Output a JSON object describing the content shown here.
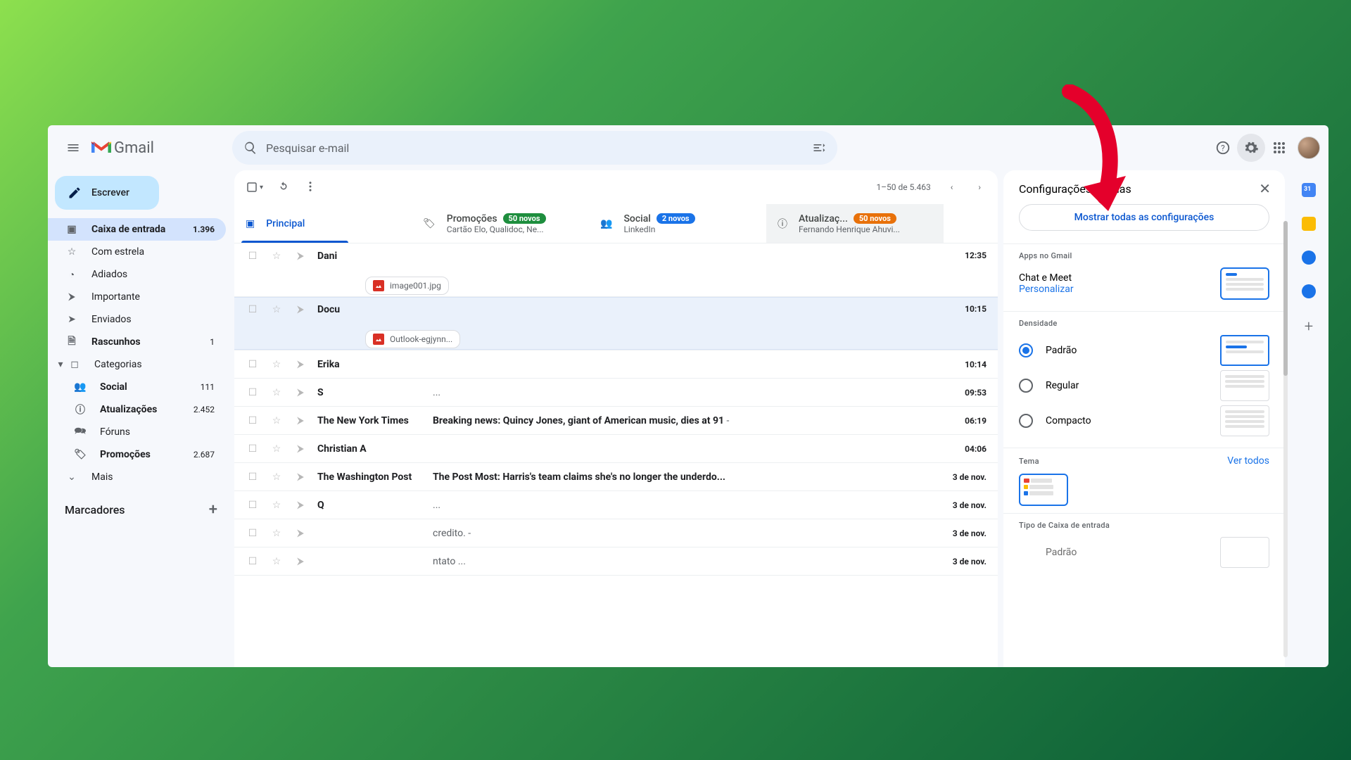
{
  "app": {
    "name": "Gmail"
  },
  "search": {
    "placeholder": "Pesquisar e-mail"
  },
  "compose": {
    "label": "Escrever"
  },
  "nav": {
    "inbox": {
      "label": "Caixa de entrada",
      "count": "1.396"
    },
    "starred": {
      "label": "Com estrela"
    },
    "snoozed": {
      "label": "Adiados"
    },
    "important": {
      "label": "Importante"
    },
    "sent": {
      "label": "Enviados"
    },
    "drafts": {
      "label": "Rascunhos",
      "count": "1"
    },
    "categories": {
      "label": "Categorias"
    },
    "social": {
      "label": "Social",
      "count": "111"
    },
    "updates": {
      "label": "Atualizações",
      "count": "2.452"
    },
    "forums": {
      "label": "Fóruns"
    },
    "promotions": {
      "label": "Promoções",
      "count": "2.687"
    },
    "more": {
      "label": "Mais"
    }
  },
  "labels_header": "Marcadores",
  "toolbar": {
    "range": "1–50 de 5.463"
  },
  "tabs": {
    "primary": {
      "label": "Principal"
    },
    "promo": {
      "label": "Promoções",
      "badge": "50 novos",
      "sub": "Cartão Elo, Qualidoc, Ne..."
    },
    "social": {
      "label": "Social",
      "badge": "2 novos",
      "sub": "LinkedIn"
    },
    "updates": {
      "label": "Atualizaç...",
      "badge": "50 novos",
      "sub": "Fernando Henrique Ahuvi..."
    }
  },
  "rows": [
    {
      "sender": "Dani",
      "subject": "",
      "time": "12:35",
      "attach": "image001.jpg"
    },
    {
      "sender": "Docu",
      "subject": "",
      "time": "10:15",
      "attach": "Outlook-egjynn..."
    },
    {
      "sender": "Erika",
      "subject": "",
      "time": "10:14"
    },
    {
      "sender": "S",
      "subject": "",
      "snip": "...",
      "time": "09:53"
    },
    {
      "sender": "The New York Times",
      "subject": "Breaking news: Quincy Jones, giant of American music, dies at 91",
      "snip": " - ",
      "time": "06:19"
    },
    {
      "sender": "Christian A",
      "subject": "",
      "time": "04:06"
    },
    {
      "sender": "The Washington Post",
      "subject": "The Post Most: Harris's team claims she's no longer the underdo...",
      "time": "3 de nov."
    },
    {
      "sender": "Q",
      "subject": "",
      "snip": "...",
      "time": "3 de nov."
    },
    {
      "sender": "",
      "subject": "",
      "snip": "credito. - ",
      "time": "3 de nov."
    },
    {
      "sender": "",
      "subject": "",
      "snip": "ntato ...",
      "time": "3 de nov."
    }
  ],
  "settings": {
    "title": "Configurações rápidas",
    "show_all": "Mostrar todas as configurações",
    "apps_title": "Apps no Gmail",
    "chat_meet": "Chat e Meet",
    "customize": "Personalizar",
    "density_title": "Densidade",
    "density": {
      "default": "Padrão",
      "comfortable": "Regular",
      "compact": "Compacto"
    },
    "theme_title": "Tema",
    "see_all": "Ver todos",
    "inbox_type_title": "Tipo de Caixa de entrada",
    "inbox_default": "Padrão"
  }
}
